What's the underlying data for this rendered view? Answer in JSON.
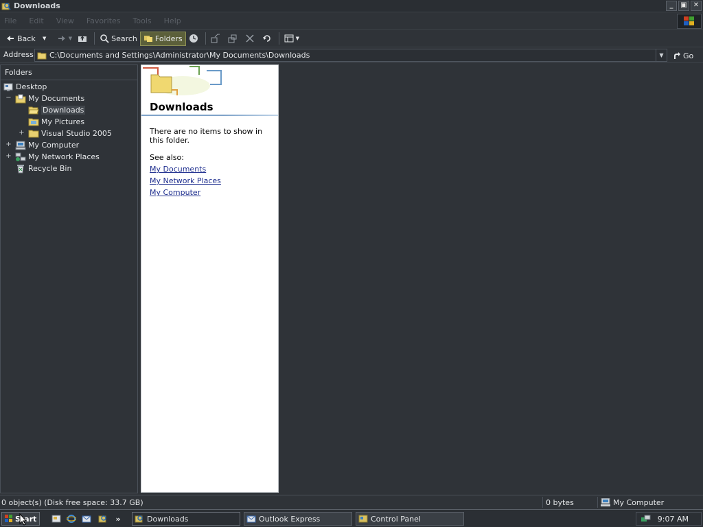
{
  "window": {
    "title": "Downloads",
    "controls": {
      "minimize": "_",
      "maximize": "▣",
      "close": "✕"
    }
  },
  "menu": {
    "items": [
      "File",
      "Edit",
      "View",
      "Favorites",
      "Tools",
      "Help"
    ]
  },
  "toolbar": {
    "back_label": "Back",
    "search_label": "Search",
    "folders_label": "Folders"
  },
  "address": {
    "label": "Address",
    "path": "C:\\Documents and Settings\\Administrator\\My Documents\\Downloads",
    "go_label": "Go"
  },
  "folders": {
    "header": "Folders",
    "tree": [
      {
        "label": "Desktop",
        "icon": "desktop-icon"
      },
      {
        "label": "My Documents",
        "icon": "my-documents-icon",
        "expander": "−"
      },
      {
        "label": "Downloads",
        "icon": "folder-open-icon",
        "selected": true
      },
      {
        "label": "My Pictures",
        "icon": "my-pictures-icon"
      },
      {
        "label": "Visual Studio 2005",
        "icon": "folder-icon",
        "expander": "+"
      },
      {
        "label": "My Computer",
        "icon": "my-computer-icon",
        "expander": "+"
      },
      {
        "label": "My Network Places",
        "icon": "network-places-icon",
        "expander": "+"
      },
      {
        "label": "Recycle Bin",
        "icon": "recycle-bin-icon"
      }
    ]
  },
  "webview": {
    "title": "Downloads",
    "empty_message": "There are no items to show in this folder.",
    "see_also": "See also:",
    "links": [
      "My Documents",
      "My Network Places",
      "My Computer"
    ]
  },
  "status": {
    "objects": "0 object(s) (Disk free space: 33.7 GB)",
    "size": "0 bytes",
    "zone": "My Computer"
  },
  "taskbar": {
    "start_label": "Start",
    "quicklaunch_more": "»",
    "tasks": [
      "Downloads",
      "Outlook Express",
      "Control Panel"
    ],
    "clock": "9:07 AM"
  },
  "colors": {
    "window_bg": "#2f3338",
    "folders_button_active": "#5b5f3a",
    "link": "#1f2f8f",
    "webview_bg": "#ffffff"
  }
}
